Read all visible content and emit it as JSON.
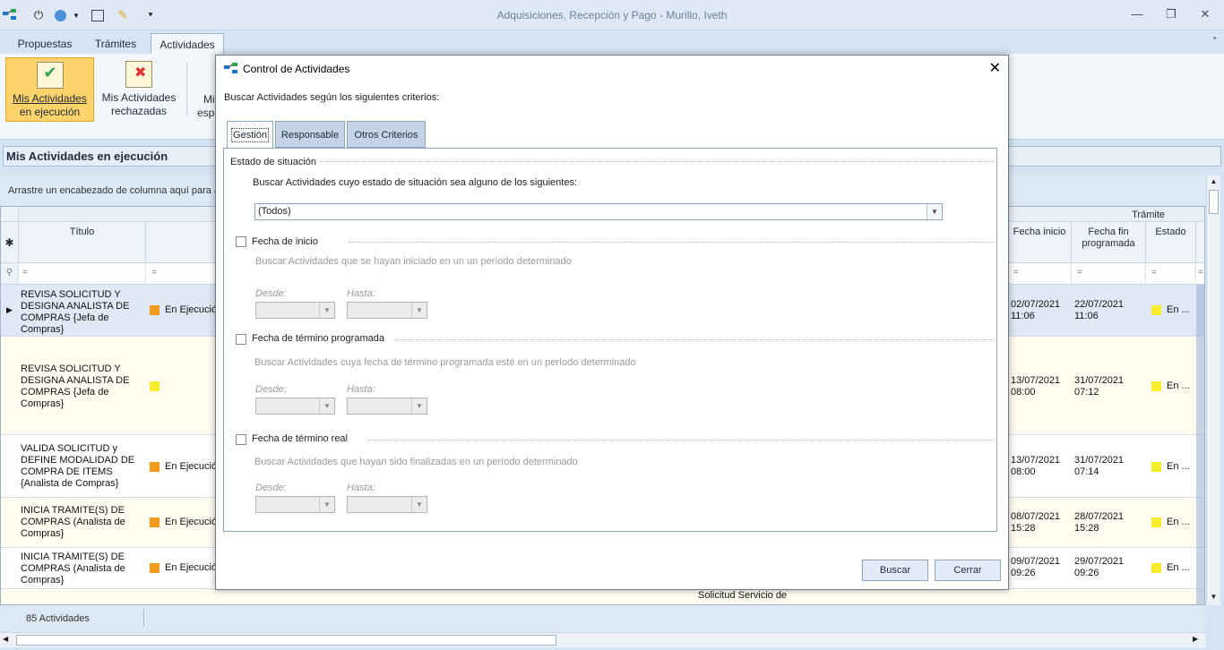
{
  "window": {
    "title": "Adquisiciones, Recepción y Pago - Murillo, Iveth"
  },
  "tabs": [
    {
      "label": "Propuestas"
    },
    {
      "label": "Trámites"
    },
    {
      "label": "Actividades"
    }
  ],
  "ribbon": {
    "btn1_line1": "Mis Actividades",
    "btn1_line2": "en ejecución",
    "btn2_line1": "Mis Actividades",
    "btn2_line2": "rechazadas",
    "btn3_line1": "Mi",
    "btn3_line2": "esp"
  },
  "section": {
    "title": "Mis Actividades en ejecución"
  },
  "grid": {
    "group_hint": "Arrastre un encabezado de columna aquí para ag",
    "group_header_tramite": "Trámite",
    "col_titulo": "Título",
    "col_fecha_inicio": "Fecha inicio",
    "col_fecha_fin_l1": "Fecha fin",
    "col_fecha_fin_l2": "programada",
    "col_estado": "Estado",
    "filter_symbol": "=",
    "rows": [
      {
        "titulo": "REVISA SOLICITUD Y DESIGNA ANALISTA DE COMPRAS {Jefa de Compras}",
        "estado_act": "En Ejecución",
        "inicio": "02/07/2021 11:06",
        "fin": "22/07/2021 11:06",
        "estado": "En ..."
      },
      {
        "titulo": "REVISA SOLICITUD Y DESIGNA ANALISTA DE COMPRAS {Jefa de Compras}",
        "estado_act": "",
        "inicio": "13/07/2021 08:00",
        "fin": "31/07/2021 07:12",
        "estado": "En ..."
      },
      {
        "titulo": "VALIDA SOLICITUD y DEFINE MODALIDAD DE COMPRA DE ITEMS {Analista de Compras}",
        "estado_act": "En Ejecución",
        "inicio": "13/07/2021 08:00",
        "fin": "31/07/2021 07:14",
        "estado": "En ..."
      },
      {
        "titulo": "INICIA TRÁMITE(S) DE COMPRAS (Analista de Compras}",
        "estado_act": "En Ejecución",
        "inicio": "08/07/2021 15:28",
        "fin": "28/07/2021 15:28",
        "estado": "En ..."
      },
      {
        "titulo": "INICIA TRÁMITE(S) DE COMPRAS (Analista de Compras}",
        "estado_act": "En Ejecución",
        "inicio": "09/07/2021 09:26",
        "fin": "29/07/2021 09:26",
        "estado": "En ..."
      }
    ],
    "partial_row_text": "Solicitud Servicio de"
  },
  "status": {
    "count": "85 Actividades"
  },
  "dialog": {
    "title": "Control de Actividades",
    "intro": "Buscar Actividades según los siguientes criterios:",
    "tabs": [
      {
        "label": "Gestión"
      },
      {
        "label": "Responsable"
      },
      {
        "label": "Otros Criterios"
      }
    ],
    "estado_section": "Estado de situación",
    "estado_prompt": "Buscar Actividades cuyo estado de situación sea alguno de los siguientes:",
    "estado_value": "(Todos)",
    "fecha_inicio_label": "Fecha de inicio",
    "fecha_inicio_desc": "Buscar Actividades que se hayan iniciado en un un período determinado",
    "fecha_termino_prog_label": "Fecha de término programada",
    "fecha_termino_prog_desc": "Buscar Actividades cuya fecha de término programada esté en un período determinado",
    "fecha_termino_real_label": "Fecha de término real",
    "fecha_termino_real_desc": "Buscar Actividades que hayan sido finalizadas en un período determinado",
    "desde_label": "Desde:",
    "hasta_label": "Hasta:",
    "buscar_button": "Buscar",
    "cerrar_button": "Cerrar"
  },
  "colors": {
    "accent": "#fbd36a",
    "status_orange": "#f29a1c",
    "status_yellow": "#f5ec2a",
    "row_selected": "#dfe8f4"
  }
}
